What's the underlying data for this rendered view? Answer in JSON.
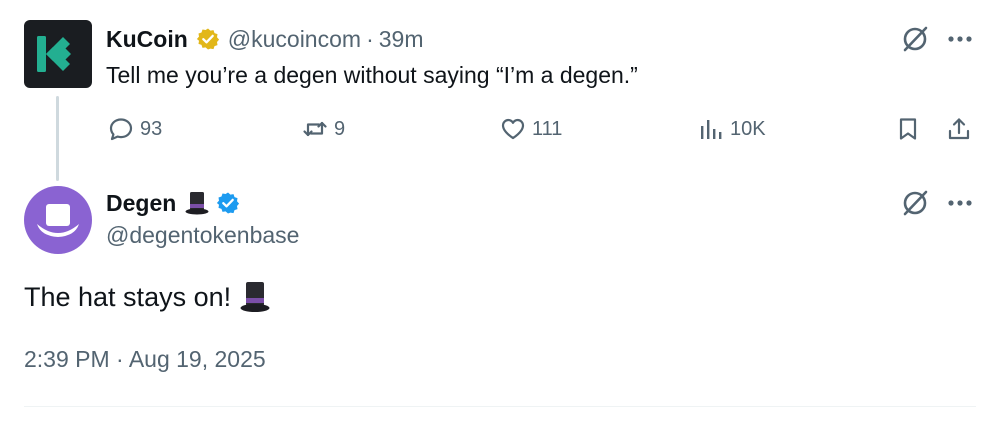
{
  "tweet1": {
    "author_name": "KuCoin",
    "handle": "@kucoincom",
    "separator": "·",
    "time": "39m",
    "text": "Tell me you’re a degen without saying “I’m a degen.”",
    "actions": {
      "replies": "93",
      "reposts": "9",
      "likes": "111",
      "views": "10K"
    },
    "icons": {
      "avatar": "kucoin-logo",
      "verified": "gold-verified-badge",
      "grok": "grok-icon",
      "more": "more-icon",
      "reply": "reply-icon",
      "repost": "repost-icon",
      "like": "heart-icon",
      "views": "analytics-icon",
      "bookmark": "bookmark-icon",
      "share": "share-icon"
    }
  },
  "tweet2": {
    "author_name": "Degen",
    "handle": "@degentokenbase",
    "text": "The hat stays on!",
    "timestamp": "2:39 PM · Aug 19, 2025",
    "icons": {
      "avatar": "degen-hat-avatar",
      "name_emoji": "top-hat-emoji",
      "verified": "blue-verified-badge",
      "grok": "grok-icon",
      "more": "more-icon"
    }
  },
  "colors": {
    "text_primary": "#0f1419",
    "text_secondary": "#536471",
    "verified_blue": "#1d9bf0",
    "verified_gold": "#e2b719",
    "kucoin_green": "#23af91",
    "degen_purple": "#8a63d2"
  }
}
